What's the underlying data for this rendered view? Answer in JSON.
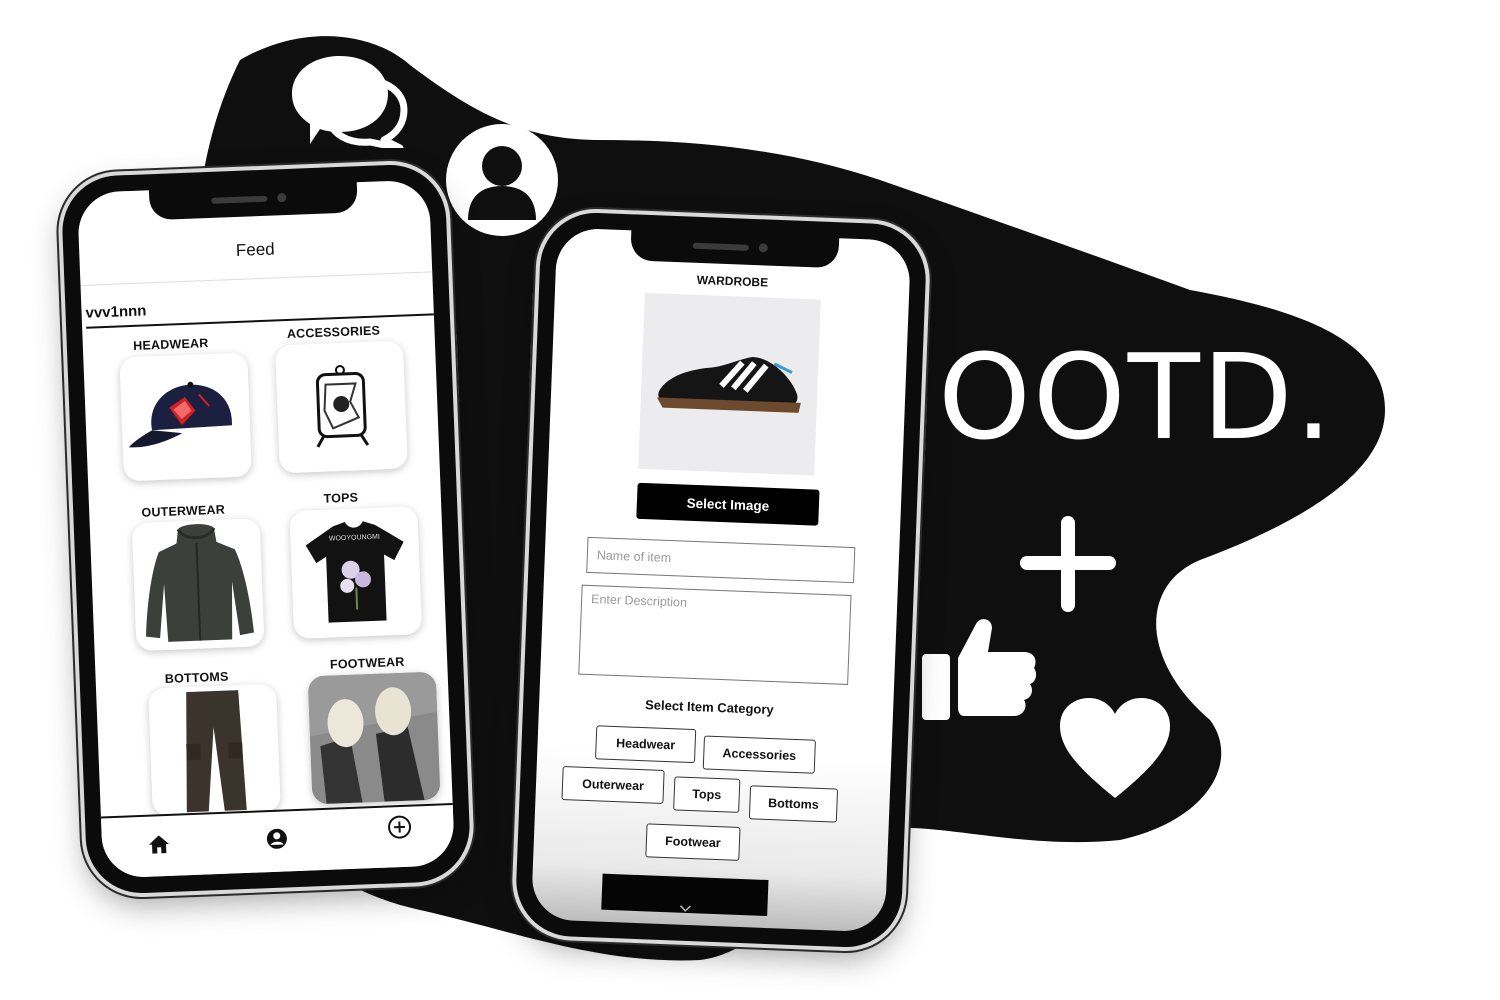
{
  "brand": {
    "title": "OOTD.",
    "accent": "#0f0f0f"
  },
  "icons": {
    "chat": "chat-bubbles-icon",
    "profile": "profile-icon",
    "like": "thumbs-up-icon",
    "heart": "heart-icon",
    "plus": "plus-icon"
  },
  "feed": {
    "title": "Feed",
    "username": "vvv1nnn",
    "categories": [
      {
        "label": "HEADWEAR",
        "item": "cap"
      },
      {
        "label": "ACCESSORIES",
        "item": "pendant"
      },
      {
        "label": "OUTERWEAR",
        "item": "hoodie"
      },
      {
        "label": "TOPS",
        "item": "tshirt"
      },
      {
        "label": "BOTTOMS",
        "item": "cargo-pants"
      },
      {
        "label": "FOOTWEAR",
        "item": "sneakers-photo"
      }
    ],
    "nav": {
      "home": "home-icon",
      "profile": "user-icon",
      "add": "add-circle-icon"
    }
  },
  "wardrobe": {
    "title": "WARDROBE",
    "select_image": "Select Image",
    "name_placeholder": "Name of item",
    "description_placeholder": "Enter Description",
    "category_heading": "Select Item Category",
    "chips": [
      "Headwear",
      "Accessories",
      "Outerwear",
      "Tops",
      "Bottoms",
      "Footwear"
    ]
  }
}
